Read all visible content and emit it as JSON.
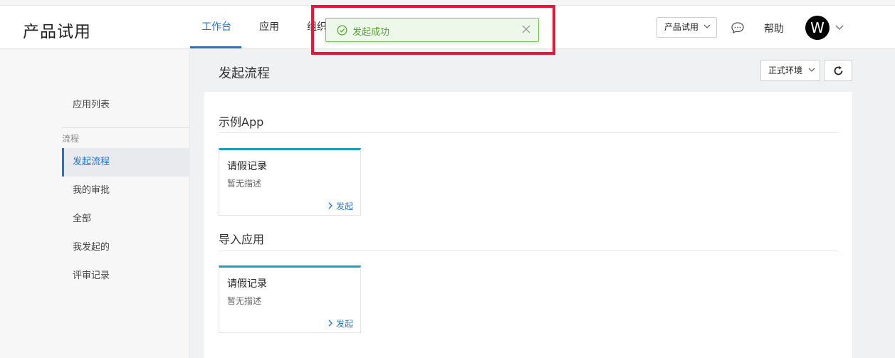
{
  "app": {
    "title": "产品试用"
  },
  "nav": {
    "tabs": [
      {
        "label": "工作台",
        "active": true
      },
      {
        "label": "应用",
        "active": false
      },
      {
        "label": "组织",
        "active": false
      }
    ]
  },
  "header_right": {
    "product_select": "产品试用",
    "help": "帮助",
    "avatar_letter": "W"
  },
  "toast": {
    "message": "发起成功",
    "type": "success",
    "color": "#52a52f"
  },
  "sidebar": {
    "top_item": "应用列表",
    "group_label": "流程",
    "items": [
      {
        "label": "发起流程",
        "active": true
      },
      {
        "label": "我的审批",
        "active": false
      },
      {
        "label": "全部",
        "active": false
      },
      {
        "label": "我发起的",
        "active": false
      },
      {
        "label": "评审记录",
        "active": false
      }
    ]
  },
  "main": {
    "title": "发起流程",
    "env_select": "正式环境",
    "sections": [
      {
        "title": "示例App",
        "cards": [
          {
            "title": "请假记录",
            "desc": "暂无描述",
            "action": "发起"
          }
        ]
      },
      {
        "title": "导入应用",
        "cards": [
          {
            "title": "请假记录",
            "desc": "暂无描述",
            "action": "发起"
          }
        ]
      }
    ]
  },
  "colors": {
    "accent": "#1e74d8",
    "card_top": "#1ba0b9",
    "highlight": "#e8163a"
  }
}
